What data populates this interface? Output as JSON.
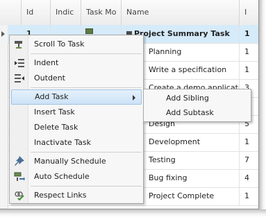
{
  "columns": [
    "Id",
    "Indic",
    "Task Mo",
    "Name",
    "I"
  ],
  "rows": [
    {
      "id": "1",
      "name": "Project Summary Task",
      "trunc": "1"
    },
    {
      "id": "",
      "name": "Planning",
      "trunc": "1"
    },
    {
      "id": "",
      "name": "Write a specification",
      "trunc": "1"
    },
    {
      "id": "",
      "name": "Create a demo application",
      "trunc": "3"
    },
    {
      "id": "",
      "name": "",
      "trunc": "1"
    },
    {
      "id": "",
      "name": "Design",
      "trunc": "5"
    },
    {
      "id": "",
      "name": "Development",
      "trunc": "1"
    },
    {
      "id": "",
      "name": "Testing",
      "trunc": "7"
    },
    {
      "id": "",
      "name": "Bug fixing",
      "trunc": "4"
    },
    {
      "id": "",
      "name": "Project Complete",
      "trunc": "1"
    }
  ],
  "menu": {
    "scroll_to_task": "Scroll To Task",
    "indent": "Indent",
    "outdent": "Outdent",
    "add_task": "Add Task",
    "insert_task": "Insert Task",
    "delete_task": "Delete Task",
    "inactivate_task": "Inactivate Task",
    "manually_schedule": "Manually Schedule",
    "auto_schedule": "Auto Schedule",
    "respect_links": "Respect Links"
  },
  "submenu": {
    "add_sibling": "Add Sibling",
    "add_subtask": "Add Subtask"
  },
  "icons": {
    "scroll_to_task": "scroll-to-task-icon",
    "indent": "indent-icon",
    "outdent": "outdent-icon",
    "manually_schedule": "pin-icon",
    "auto_schedule": "auto-schedule-icon",
    "respect_links": "link-check-icon"
  },
  "colors": {
    "selection": "#d6ebfa",
    "highlight": "#cde3f7",
    "task_mode_green": "#5f7a44"
  }
}
